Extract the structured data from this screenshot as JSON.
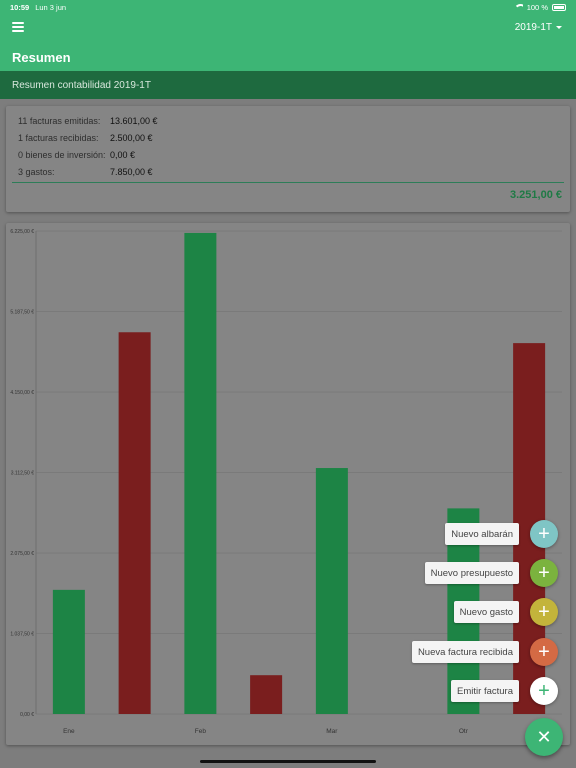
{
  "status": {
    "time": "10:59",
    "date": "Lun 3 jun",
    "battery": "100 %"
  },
  "appbar": {
    "title": "Resumen",
    "period": "2019-1T"
  },
  "subheader": "Resumen contabilidad 2019-1T",
  "summary": {
    "rows": [
      {
        "label": "11 facturas emitidas:",
        "value": "13.601,00 €"
      },
      {
        "label": "1 facturas recibidas:",
        "value": "2.500,00 €"
      },
      {
        "label": "0 bienes de inversión:",
        "value": "0,00 €"
      },
      {
        "label": "3 gastos:",
        "value": "7.850,00 €"
      }
    ],
    "total": "3.251,00 €"
  },
  "colors": {
    "income": "#1d8445",
    "expense": "#7a1e1e",
    "grid": "#6e6e6e"
  },
  "chart_data": {
    "type": "bar",
    "categories": [
      "Ene",
      "",
      "Feb",
      "",
      "Mar",
      "",
      "Otr",
      ""
    ],
    "series": [
      {
        "values": [
          1600,
          4920,
          6200,
          500,
          3170,
          0,
          2650,
          4780
        ]
      }
    ],
    "series_kind": [
      "income",
      "expense",
      "income",
      "expense",
      "income",
      "expense",
      "income",
      "expense"
    ],
    "ylim": [
      0,
      6225
    ],
    "yticks": [
      0,
      1037.5,
      2075,
      3112.5,
      4150,
      5187.5,
      6225
    ],
    "ytick_labels": [
      "0,00 €",
      "1.037,50 €",
      "2.075,00 €",
      "3.112,50 €",
      "4.150,00 €",
      "5.187,50 €",
      "6.225,00 €"
    ],
    "grid": true,
    "legend": "none"
  },
  "fab": {
    "items": [
      {
        "label": "Nuevo albarán",
        "color": "#7fc5c5",
        "icon": "plus-icon"
      },
      {
        "label": "Nuevo presupuesto",
        "color": "#7bb33e",
        "icon": "plus-icon"
      },
      {
        "label": "Nuevo gasto",
        "color": "#c3b43b",
        "icon": "plus-icon"
      },
      {
        "label": "Nueva factura recibida",
        "color": "#d46a44",
        "icon": "plus-icon"
      },
      {
        "label": "Emitir factura",
        "color": "#ffffff",
        "icon": "plus-icon"
      }
    ],
    "plus": "+",
    "close": "✕"
  }
}
